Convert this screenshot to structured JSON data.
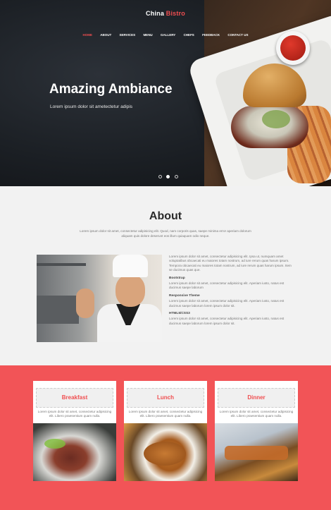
{
  "brand": {
    "name": "China",
    "accent": "Bistro"
  },
  "nav": [
    {
      "label": "HOME",
      "active": true
    },
    {
      "label": "ABOUT",
      "active": false
    },
    {
      "label": "SERVICES",
      "active": false
    },
    {
      "label": "MENU",
      "active": false
    },
    {
      "label": "GALLERY",
      "active": false
    },
    {
      "label": "CHEFS",
      "active": false
    },
    {
      "label": "FEEDBACK",
      "active": false
    },
    {
      "label": "CONTACT US",
      "active": false
    }
  ],
  "hero": {
    "title": "Amazing Ambiance",
    "subtitle": "Lorem ipsum dolor sit ametectetur adipis",
    "slides": 3,
    "active_slide": 2
  },
  "about": {
    "title": "About",
    "intro": "Lorem ipsum dolor sit amet, consectetur adipisicing elit. Quod, nam corporis quas, saepe minima error aperiam dolorum aliquam quis dolore deserunt eos illum quiaquam odio neque.",
    "lead": "Lorem ipsum dolor sit amet, consectetur adipisicing elit. Ipsa ut, numquam amet voluptatibus obcaecati eu maiores totam nostrum, ad iure rerum quas harum ipsum. Tempora obcaecati eu maiores totam nostrum, ad iure rerum quas harum ipsum. Item se ducimus quas que.",
    "features": [
      {
        "heading": "Bootstrap",
        "text": "Lorem ipsum dolor sit amet, consectetur adipisicing elit. Aperiam iusto, natus est ducimus saepe laborum"
      },
      {
        "heading": "Responsive Theme",
        "text": "Lorem ipsum dolor sit amet, consectetur adipisicing elit. Aperiam iusto, natus est ducimus saepe laborum lorem ipsum dolor sit."
      },
      {
        "heading": "HTML5/CSS3",
        "text": "Lorem ipsum dolor sit amet, consectetur adipisicing elit. Aperiam iusto, natus est ducimus saepe laborum lorem ipsum dolor sit."
      }
    ]
  },
  "menu": {
    "cards": [
      {
        "title": "Breakfast",
        "desc": "Lorem ipsum dolor sit amet, consectetur adipisicing elit. Libero praesentium quam nulla."
      },
      {
        "title": "Lunch",
        "desc": "Lorem ipsum dolor sit amet, consectetur adipisicing elit. Libero praesentium quam nulla."
      },
      {
        "title": "Dinner",
        "desc": "Lorem ipsum dolor sit amet, consectetur adipisicing elit. Libero praesentium quam nulla."
      }
    ]
  },
  "colors": {
    "accent": "#f04e50",
    "menu_bg": "#f25457",
    "about_bg": "#f2f2f2",
    "hero_bg": "#1b1f24"
  }
}
